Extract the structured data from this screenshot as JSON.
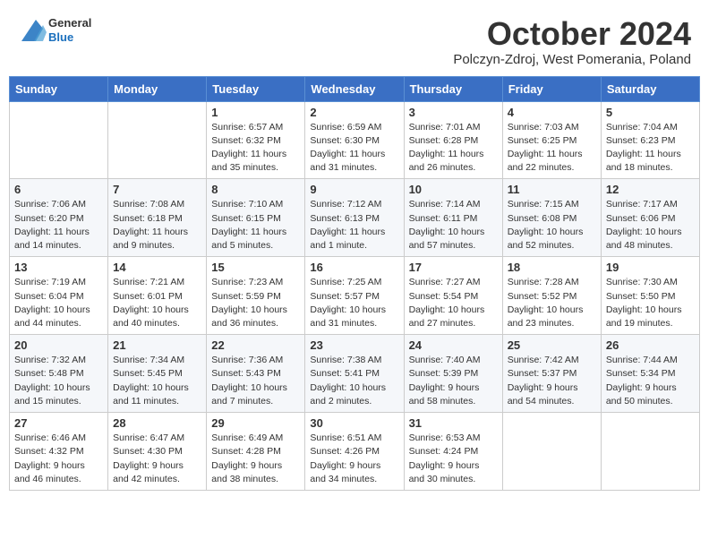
{
  "header": {
    "logo": {
      "general": "General",
      "blue": "Blue"
    },
    "title": "October 2024",
    "location": "Polczyn-Zdroj, West Pomerania, Poland"
  },
  "days_of_week": [
    "Sunday",
    "Monday",
    "Tuesday",
    "Wednesday",
    "Thursday",
    "Friday",
    "Saturday"
  ],
  "weeks": [
    [
      {
        "day": "",
        "info": ""
      },
      {
        "day": "",
        "info": ""
      },
      {
        "day": "1",
        "info": "Sunrise: 6:57 AM\nSunset: 6:32 PM\nDaylight: 11 hours and 35 minutes."
      },
      {
        "day": "2",
        "info": "Sunrise: 6:59 AM\nSunset: 6:30 PM\nDaylight: 11 hours and 31 minutes."
      },
      {
        "day": "3",
        "info": "Sunrise: 7:01 AM\nSunset: 6:28 PM\nDaylight: 11 hours and 26 minutes."
      },
      {
        "day": "4",
        "info": "Sunrise: 7:03 AM\nSunset: 6:25 PM\nDaylight: 11 hours and 22 minutes."
      },
      {
        "day": "5",
        "info": "Sunrise: 7:04 AM\nSunset: 6:23 PM\nDaylight: 11 hours and 18 minutes."
      }
    ],
    [
      {
        "day": "6",
        "info": "Sunrise: 7:06 AM\nSunset: 6:20 PM\nDaylight: 11 hours and 14 minutes."
      },
      {
        "day": "7",
        "info": "Sunrise: 7:08 AM\nSunset: 6:18 PM\nDaylight: 11 hours and 9 minutes."
      },
      {
        "day": "8",
        "info": "Sunrise: 7:10 AM\nSunset: 6:15 PM\nDaylight: 11 hours and 5 minutes."
      },
      {
        "day": "9",
        "info": "Sunrise: 7:12 AM\nSunset: 6:13 PM\nDaylight: 11 hours and 1 minute."
      },
      {
        "day": "10",
        "info": "Sunrise: 7:14 AM\nSunset: 6:11 PM\nDaylight: 10 hours and 57 minutes."
      },
      {
        "day": "11",
        "info": "Sunrise: 7:15 AM\nSunset: 6:08 PM\nDaylight: 10 hours and 52 minutes."
      },
      {
        "day": "12",
        "info": "Sunrise: 7:17 AM\nSunset: 6:06 PM\nDaylight: 10 hours and 48 minutes."
      }
    ],
    [
      {
        "day": "13",
        "info": "Sunrise: 7:19 AM\nSunset: 6:04 PM\nDaylight: 10 hours and 44 minutes."
      },
      {
        "day": "14",
        "info": "Sunrise: 7:21 AM\nSunset: 6:01 PM\nDaylight: 10 hours and 40 minutes."
      },
      {
        "day": "15",
        "info": "Sunrise: 7:23 AM\nSunset: 5:59 PM\nDaylight: 10 hours and 36 minutes."
      },
      {
        "day": "16",
        "info": "Sunrise: 7:25 AM\nSunset: 5:57 PM\nDaylight: 10 hours and 31 minutes."
      },
      {
        "day": "17",
        "info": "Sunrise: 7:27 AM\nSunset: 5:54 PM\nDaylight: 10 hours and 27 minutes."
      },
      {
        "day": "18",
        "info": "Sunrise: 7:28 AM\nSunset: 5:52 PM\nDaylight: 10 hours and 23 minutes."
      },
      {
        "day": "19",
        "info": "Sunrise: 7:30 AM\nSunset: 5:50 PM\nDaylight: 10 hours and 19 minutes."
      }
    ],
    [
      {
        "day": "20",
        "info": "Sunrise: 7:32 AM\nSunset: 5:48 PM\nDaylight: 10 hours and 15 minutes."
      },
      {
        "day": "21",
        "info": "Sunrise: 7:34 AM\nSunset: 5:45 PM\nDaylight: 10 hours and 11 minutes."
      },
      {
        "day": "22",
        "info": "Sunrise: 7:36 AM\nSunset: 5:43 PM\nDaylight: 10 hours and 7 minutes."
      },
      {
        "day": "23",
        "info": "Sunrise: 7:38 AM\nSunset: 5:41 PM\nDaylight: 10 hours and 2 minutes."
      },
      {
        "day": "24",
        "info": "Sunrise: 7:40 AM\nSunset: 5:39 PM\nDaylight: 9 hours and 58 minutes."
      },
      {
        "day": "25",
        "info": "Sunrise: 7:42 AM\nSunset: 5:37 PM\nDaylight: 9 hours and 54 minutes."
      },
      {
        "day": "26",
        "info": "Sunrise: 7:44 AM\nSunset: 5:34 PM\nDaylight: 9 hours and 50 minutes."
      }
    ],
    [
      {
        "day": "27",
        "info": "Sunrise: 6:46 AM\nSunset: 4:32 PM\nDaylight: 9 hours and 46 minutes."
      },
      {
        "day": "28",
        "info": "Sunrise: 6:47 AM\nSunset: 4:30 PM\nDaylight: 9 hours and 42 minutes."
      },
      {
        "day": "29",
        "info": "Sunrise: 6:49 AM\nSunset: 4:28 PM\nDaylight: 9 hours and 38 minutes."
      },
      {
        "day": "30",
        "info": "Sunrise: 6:51 AM\nSunset: 4:26 PM\nDaylight: 9 hours and 34 minutes."
      },
      {
        "day": "31",
        "info": "Sunrise: 6:53 AM\nSunset: 4:24 PM\nDaylight: 9 hours and 30 minutes."
      },
      {
        "day": "",
        "info": ""
      },
      {
        "day": "",
        "info": ""
      }
    ]
  ]
}
